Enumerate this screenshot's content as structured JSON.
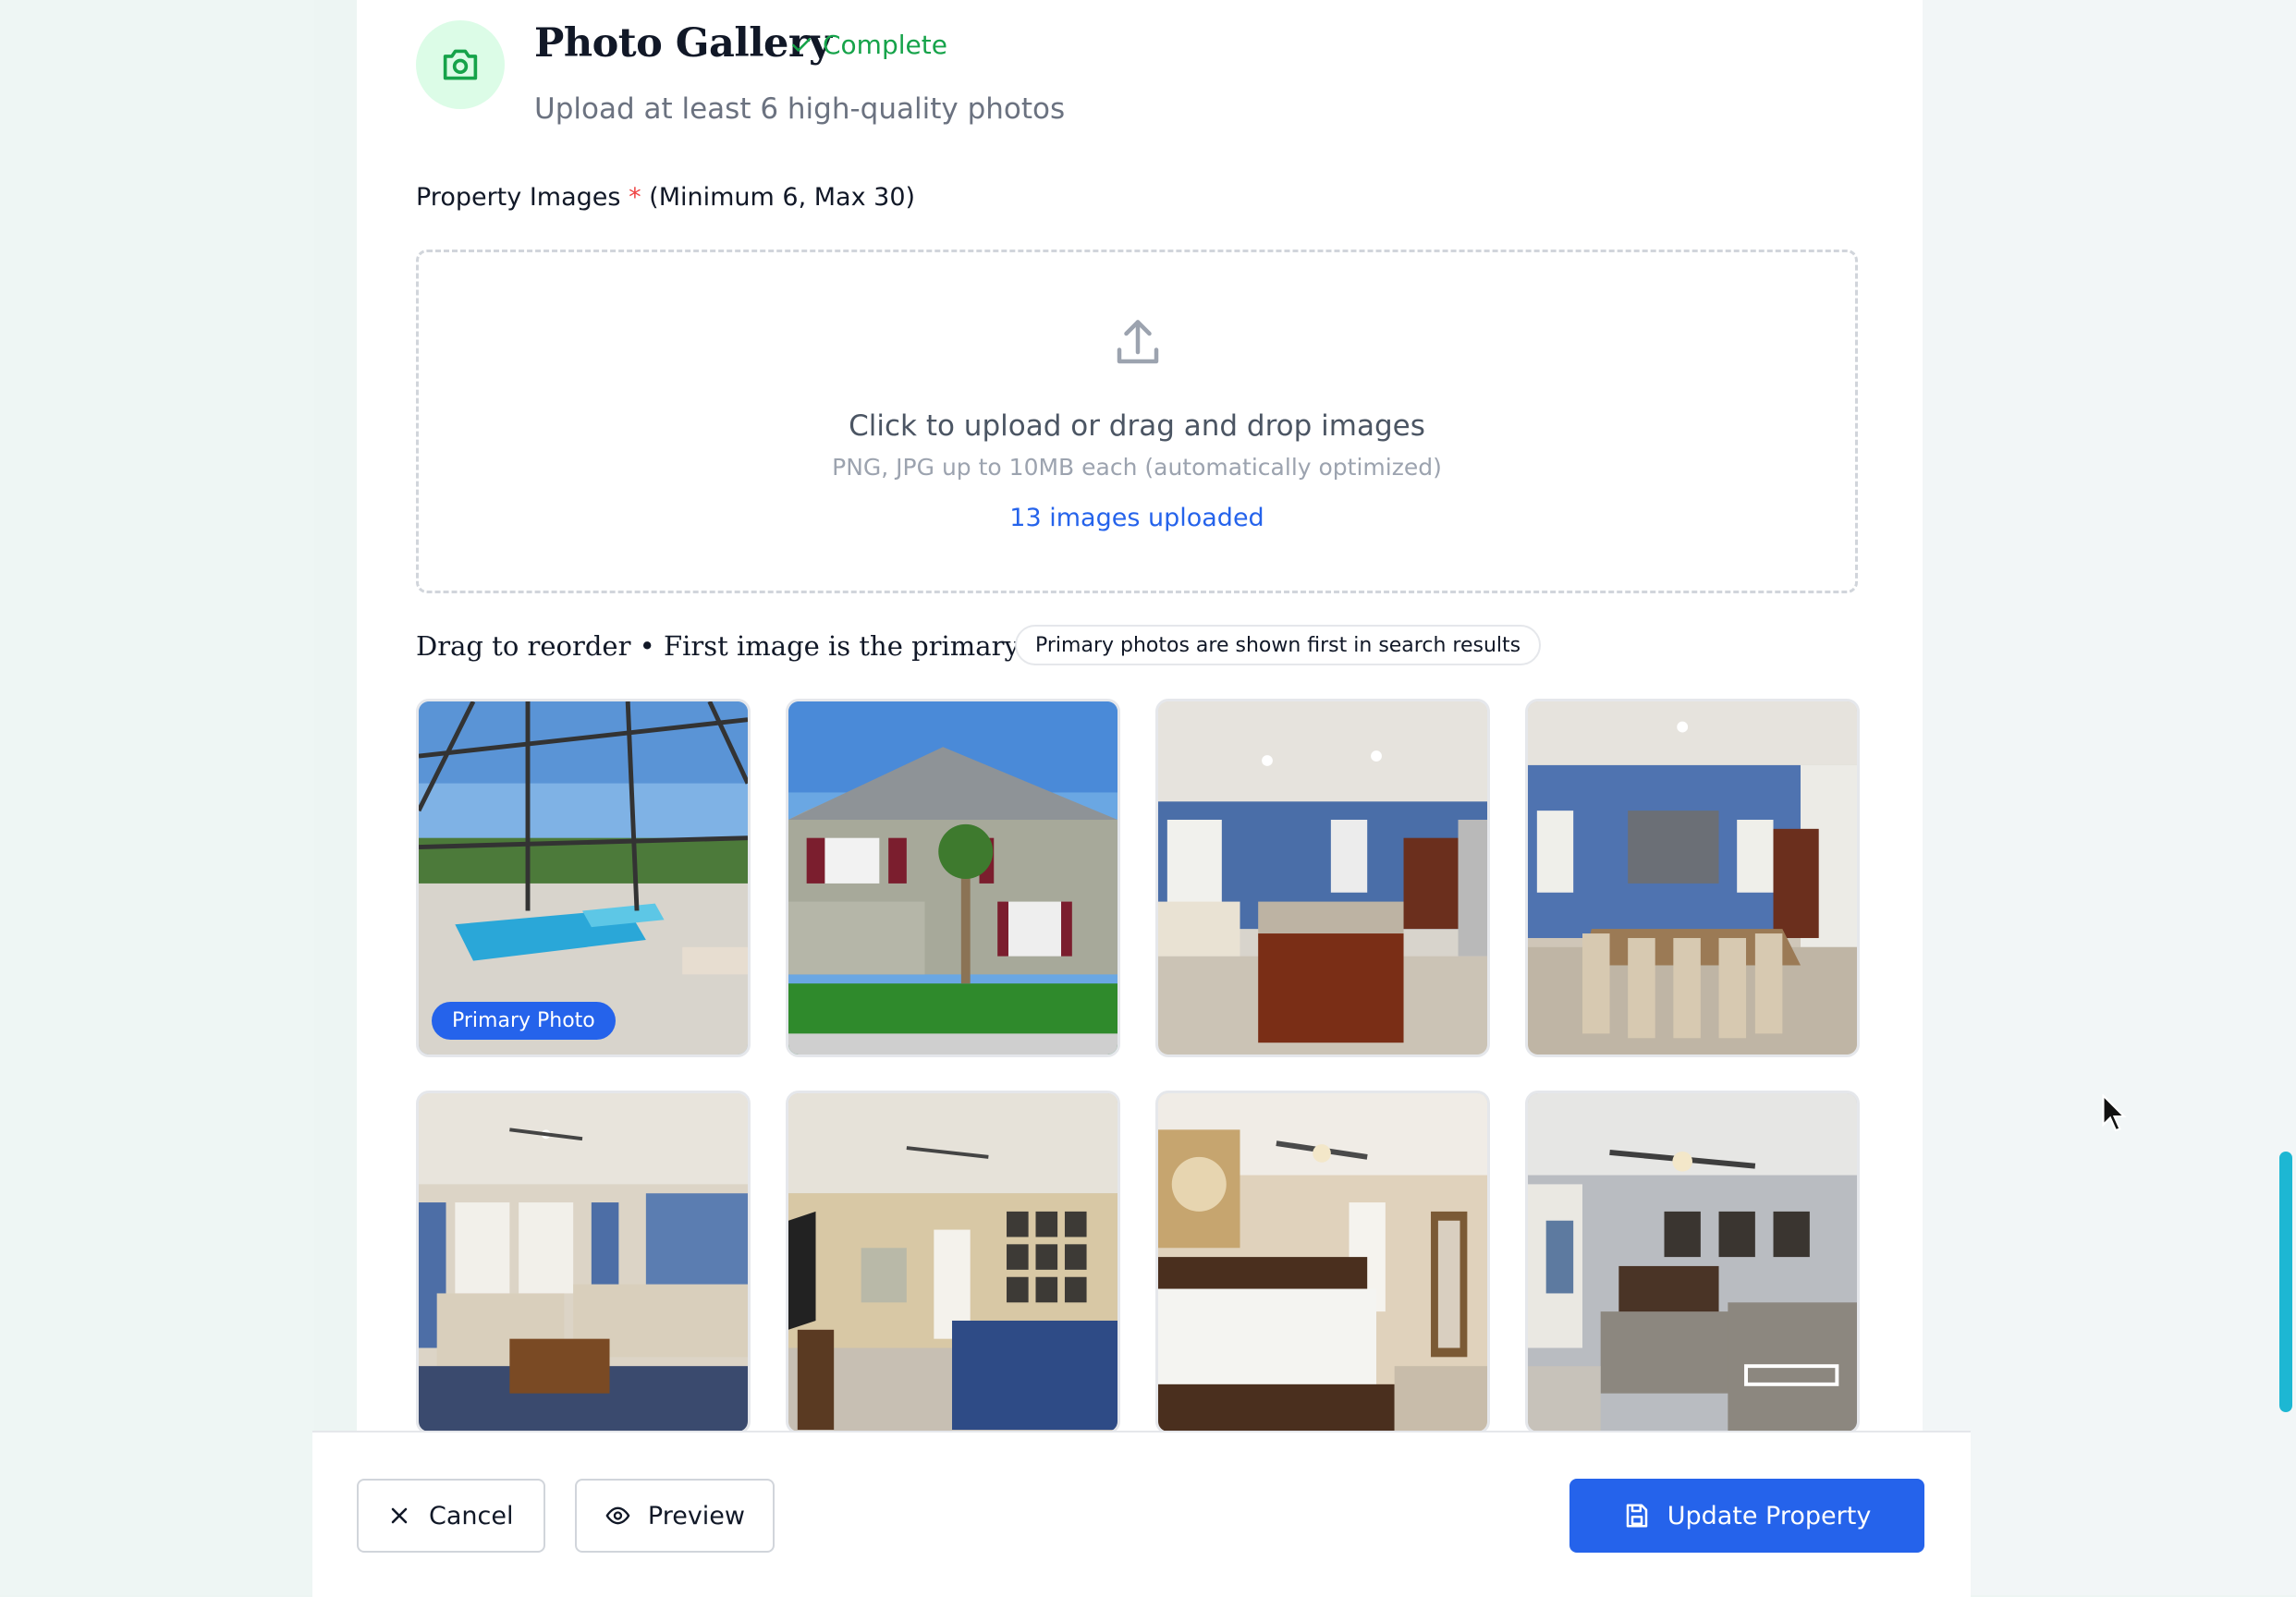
{
  "section": {
    "title": "Photo Gallery",
    "status": "Complete",
    "subtitle": "Upload at least 6 high-quality photos",
    "icon": "camera-icon"
  },
  "field": {
    "label": "Property Images",
    "required_mark": "*",
    "constraint": "(Minimum 6, Max 30)"
  },
  "upload": {
    "primary_text": "Click to upload or drag and drop images",
    "secondary_text": "PNG, JPG up to 10MB each (automatically optimized)",
    "count_text": "13 images uploaded",
    "icon": "upload-icon"
  },
  "gallery": {
    "reorder_text": "Drag to reorder • First image is the primary photo",
    "hint": "Primary photos are shown first in search results",
    "primary_badge": "Primary Photo",
    "photos": [
      {
        "subject": "screened pool"
      },
      {
        "subject": "house exterior"
      },
      {
        "subject": "kitchen"
      },
      {
        "subject": "dining room"
      },
      {
        "subject": "living room"
      },
      {
        "subject": "family room"
      },
      {
        "subject": "master bedroom"
      },
      {
        "subject": "twin bedroom"
      }
    ]
  },
  "footer": {
    "cancel_label": "Cancel",
    "preview_label": "Preview",
    "update_label": "Update Property"
  },
  "colors": {
    "accent": "#2563eb",
    "success": "#16a34a",
    "required": "#ef4444",
    "scrollbar": "#1db7d3"
  }
}
